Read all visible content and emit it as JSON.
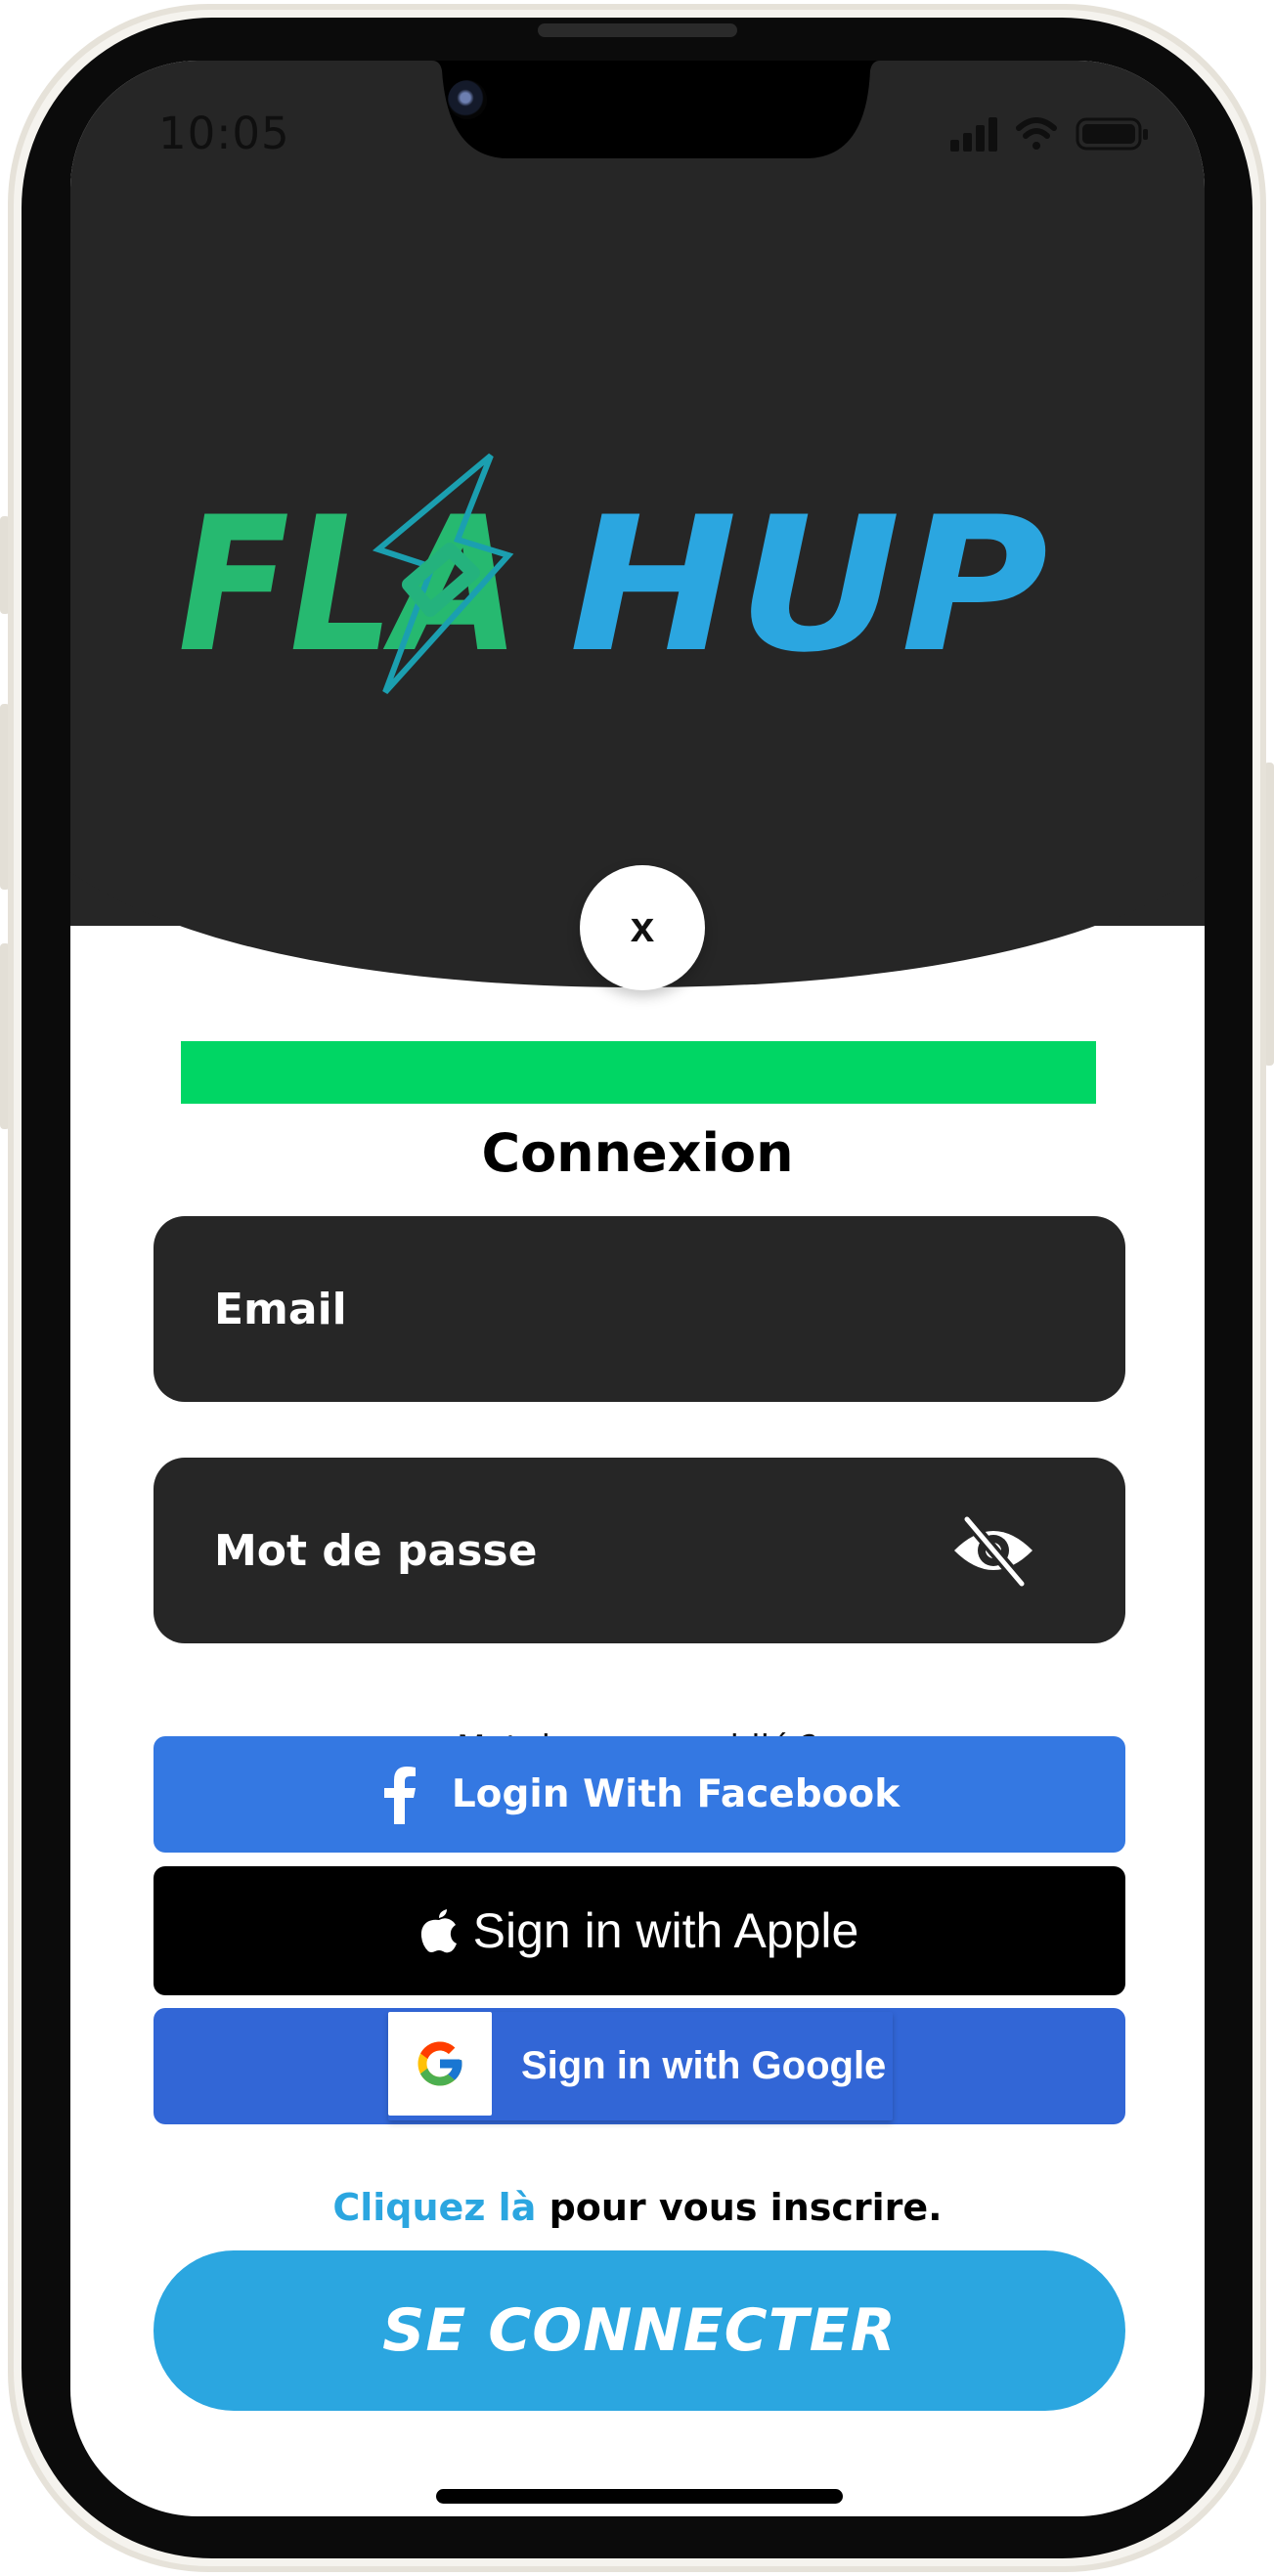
{
  "status_bar": {
    "time": "10:05"
  },
  "logo": {
    "text_left": "FLA",
    "text_right": "HUP",
    "color_left": "#26b970",
    "color_right": "#2ba6e0"
  },
  "close_button": {
    "label": "x"
  },
  "progress": {
    "value": 1.0,
    "color": "#00d664"
  },
  "form": {
    "title": "Connexion",
    "email_placeholder": "Email",
    "password_placeholder": "Mot de passe",
    "forgot_password": "Mot de passe oublié ?"
  },
  "social": {
    "facebook_label": "Login With Facebook",
    "apple_label": "Sign in with Apple",
    "google_label": "Sign in with Google"
  },
  "signup": {
    "link_text": "Cliquez là",
    "rest_text": " pour vous inscrire."
  },
  "submit": {
    "label": "SE CONNECTER"
  },
  "icons": {
    "eye": "eye-slash-icon",
    "facebook": "facebook-icon",
    "apple": "apple-icon",
    "google": "google-icon",
    "signal": "signal-icon",
    "wifi": "wifi-icon",
    "battery": "battery-icon"
  }
}
